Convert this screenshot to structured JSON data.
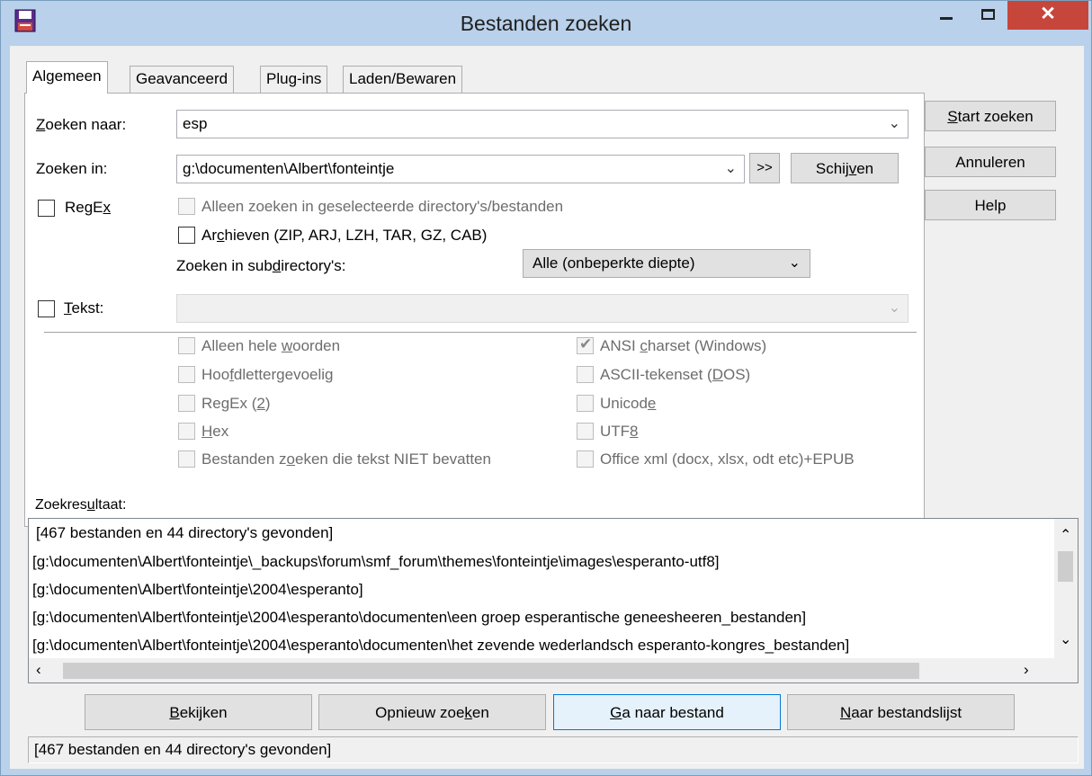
{
  "window": {
    "title": "Bestanden zoeken",
    "close_glyph": "✕"
  },
  "tabs": [
    "Algemeen",
    "Geavanceerd",
    "Plug-ins",
    "Laden/Bewaren"
  ],
  "general": {
    "search_for_label_u": "Z",
    "search_for_label_rest": "oeken naar:",
    "search_for_value": "esp",
    "search_in_label": "Zoeken in:",
    "search_in_value": "g:\\documenten\\Albert\\fonteintje",
    "more_button": ">>",
    "drives_button_pre": "Schij",
    "drives_button_u": "v",
    "drives_button_post": "en",
    "regex_label_pre": "RegE",
    "regex_label_u": "x",
    "only_selected": "Alleen zoeken in geselecteerde directory's/bestanden",
    "archives_pre": "Ar",
    "archives_u": "c",
    "archives_post": "hieven (ZIP, ARJ, LZH, TAR, GZ, CAB)",
    "subdirs_label_pre": "Zoeken in sub",
    "subdirs_label_u": "d",
    "subdirs_label_post": "irectory's:",
    "subdirs_value": "Alle (onbeperkte diepte)",
    "text_label_u": "T",
    "text_label_rest": "ekst:",
    "text_value": ""
  },
  "text_options_left": [
    {
      "pre": "Alleen hele ",
      "u": "w",
      "post": "oorden"
    },
    {
      "pre": "Hoo",
      "u": "f",
      "post": "dlettergevoelig"
    },
    {
      "pre": "RegEx (",
      "u": "2",
      "post": ")"
    },
    {
      "pre": "",
      "u": "H",
      "post": "ex"
    },
    {
      "pre": "Bestanden z",
      "u": "o",
      "post": "eken die tekst NIET bevatten"
    }
  ],
  "text_options_right": [
    {
      "pre": "ANSI ",
      "u": "c",
      "post": "harset (Windows)",
      "checked": true
    },
    {
      "pre": "ASCII-tekenset (",
      "u": "D",
      "post": "OS)",
      "checked": false
    },
    {
      "pre": "Unicod",
      "u": "e",
      "post": "",
      "checked": false
    },
    {
      "pre": "UTF",
      "u": "8",
      "post": "",
      "checked": false
    },
    {
      "pre": "Office xml (docx, xlsx, odt etc)+EPUB",
      "u": "",
      "post": "",
      "checked": false
    }
  ],
  "side_buttons": {
    "start_u": "S",
    "start_rest": "tart zoeken",
    "cancel": "Annuleren",
    "help": "Help"
  },
  "results": {
    "label_pre": "Zoekres",
    "label_u": "u",
    "label_post": "ltaat:",
    "lines": [
      "[467 bestanden en 44 directory's gevonden]",
      "[g:\\documenten\\Albert\\fonteintje\\_backups\\forum\\smf_forum\\themes\\fonteintje\\images\\esperanto-utf8]",
      "[g:\\documenten\\Albert\\fonteintje\\2004\\esperanto]",
      "[g:\\documenten\\Albert\\fonteintje\\2004\\esperanto\\documenten\\een groep esperantische geneesheeren_bestanden]",
      "[g:\\documenten\\Albert\\fonteintje\\2004\\esperanto\\documenten\\het zevende wederlandsch esperanto-kongres_bestanden]"
    ]
  },
  "bottom_buttons": {
    "view_u": "B",
    "view_rest": "ekijken",
    "research_pre": "Opnieuw zoe",
    "research_u": "k",
    "research_post": "en",
    "goto_u": "G",
    "goto_rest": "a naar bestand",
    "tolist_u": "N",
    "tolist_rest": "aar bestandslijst"
  },
  "status": "[467 bestanden en 44 directory's gevonden]",
  "colors": {
    "title_bar": "#b9d1ea",
    "close_button": "#c7463c",
    "focus_border": "#0078d7"
  }
}
